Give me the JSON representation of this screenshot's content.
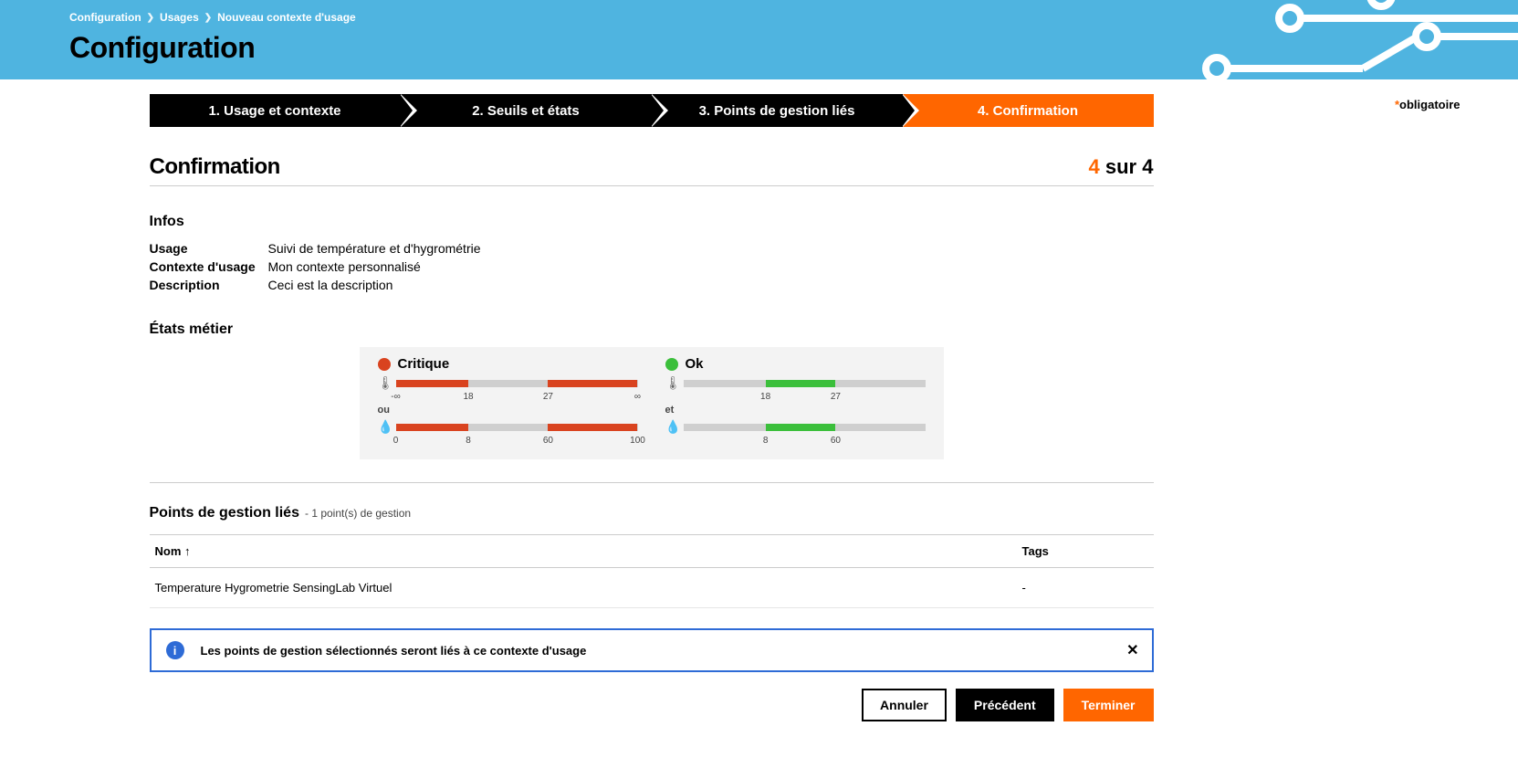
{
  "breadcrumb": {
    "a": "Configuration",
    "b": "Usages",
    "c": "Nouveau contexte d'usage"
  },
  "page_title": "Configuration",
  "required_label": "obligatoire",
  "wizard": {
    "s1": "1. Usage et contexte",
    "s2": "2. Seuils et états",
    "s3": "3. Points de gestion liés",
    "s4": "4. Confirmation"
  },
  "section": {
    "title": "Confirmation",
    "cur": "4",
    "sep": "sur",
    "total": "4"
  },
  "infos": {
    "heading": "Infos",
    "usage_label": "Usage",
    "usage_value": "Suivi de température et d'hygrométrie",
    "ctx_label": "Contexte d'usage",
    "ctx_value": "Mon contexte personnalisé",
    "desc_label": "Description",
    "desc_value": "Ceci est la description"
  },
  "states": {
    "heading": "États métier",
    "critique": "Critique",
    "ok": "Ok",
    "ou": "ou",
    "et": "et",
    "t_neg_inf": "-∞",
    "t_18": "18",
    "t_27": "27",
    "t_inf": "∞",
    "h_0": "0",
    "h_8": "8",
    "h_60": "60",
    "h_100": "100"
  },
  "linked": {
    "title": "Points de gestion liés",
    "count": "- 1 point(s) de gestion",
    "col_nom": "Nom",
    "col_tags": "Tags",
    "row_nom": "Temperature Hygrometrie SensingLab Virtuel",
    "row_tags": "-"
  },
  "banner": {
    "msg": "Les points de gestion sélectionnés seront liés à ce contexte d'usage"
  },
  "buttons": {
    "cancel": "Annuler",
    "prev": "Précédent",
    "finish": "Terminer"
  }
}
